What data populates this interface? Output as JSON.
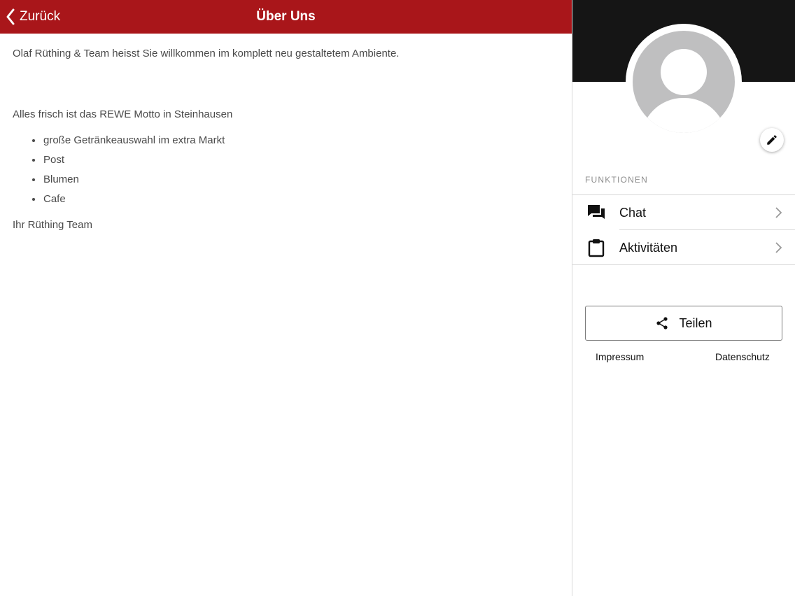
{
  "header": {
    "back_label": "Zurück",
    "title": "Über Uns",
    "bar_color": "#a9161a"
  },
  "content": {
    "welcome": "Olaf Rüthing & Team heisst Sie willkommen im komplett neu gestaltetem Ambiente.",
    "motto": "Alles frisch ist das REWE Motto in Steinhausen",
    "list": [
      "große Getränkeauswahl im extra Markt",
      "Post",
      "Blumen",
      "Cafe"
    ],
    "signature": "Ihr Rüthing Team"
  },
  "sidebar": {
    "section_label": "FUNKTIONEN",
    "items": [
      {
        "label": "Chat",
        "icon": "chat-icon"
      },
      {
        "label": "Aktivitäten",
        "icon": "clipboard-icon"
      }
    ],
    "share_label": "Teilen",
    "impressum_label": "Impressum",
    "datenschutz_label": "Datenschutz"
  }
}
